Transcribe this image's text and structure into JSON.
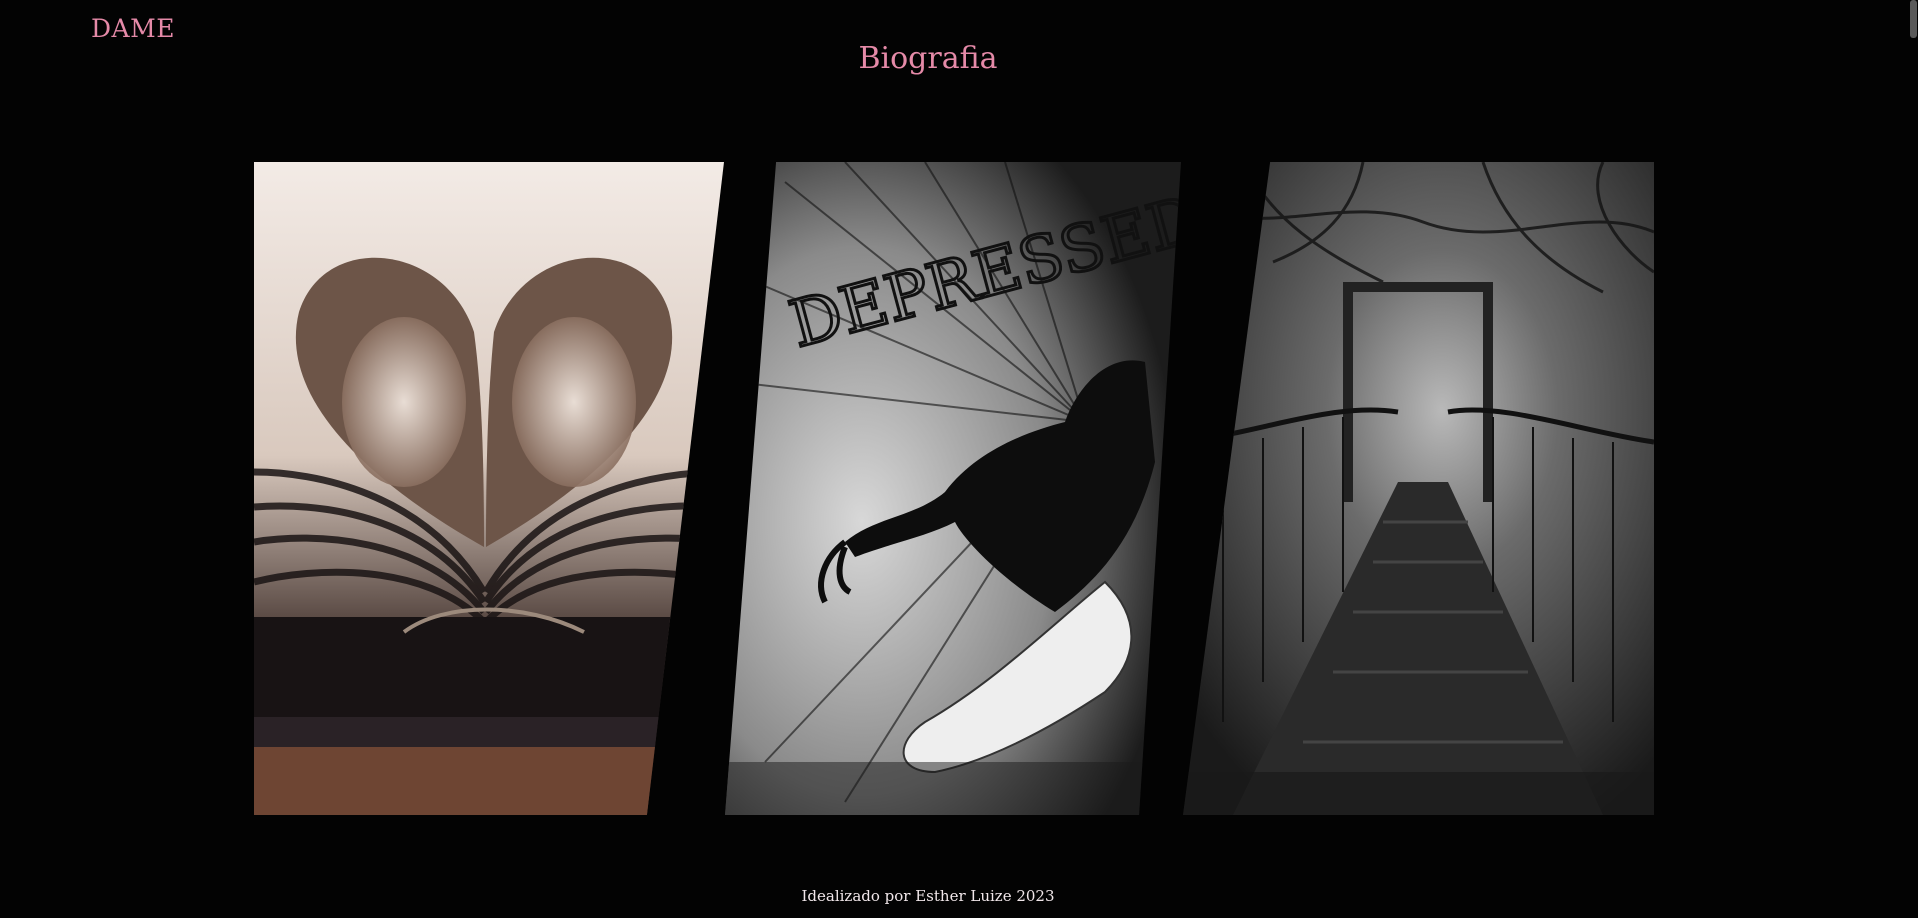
{
  "header": {
    "logo_text": "DAME",
    "title": "Biografia"
  },
  "gallery": {
    "panels": [
      {
        "subject": "heart-folded-book-pages",
        "caption": ""
      },
      {
        "subject": "dark-figure-illustration",
        "embedded_text": "DEPRESSED"
      },
      {
        "subject": "misty-suspension-bridge",
        "caption": ""
      }
    ]
  },
  "footer": {
    "credit": "Idealizado por Esther Luize 2023"
  },
  "colors": {
    "background": "#030303",
    "accent_pink": "#e58aa8",
    "footer_text": "#f1e7ea"
  }
}
